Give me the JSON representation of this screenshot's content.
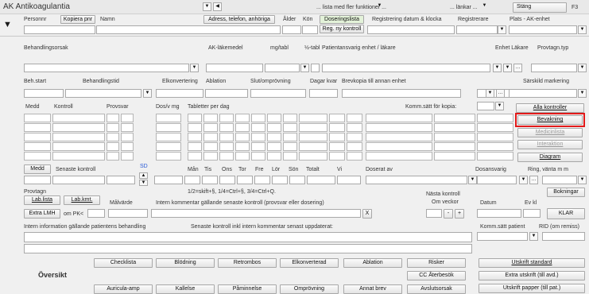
{
  "app_title": "AK Antikoagulantia",
  "top": {
    "lista_dropdown": "... lista med fler funktioner ...",
    "lankar_dropdown": "... länkar ...",
    "stang": "Stäng",
    "f3": "F3"
  },
  "row1": {
    "personnr": "Personnr",
    "kopiera_pnr": "Kopiera pnr",
    "namn": "Namn",
    "adress_btn": "Adress, telefon, anhöriga",
    "alder": "Ålder",
    "kon": "Kön",
    "doseringslista": "Doseringslista",
    "reg_ny_kontroll": "Reg. ny kontroll",
    "registrering": "Registrering datum & klocka",
    "registrerare": "Registrerare",
    "plats": "Plats - AK-enhet"
  },
  "row2": {
    "behandlingsorsak": "Behandlingsorsak",
    "ak_lakemedel": "AK-läkemedel",
    "mg_tabl": "mg/tabl",
    "half_tabl": "½-tabl",
    "patientansvarig": "Patientansvarig enhet / läkare",
    "enhet_lakare": "Enhet Läkare",
    "provtagn_typ": "Provtagn.typ"
  },
  "row3": {
    "beh_start": "Beh.start",
    "behandlingstid": "Behandlingstid",
    "elkonvertering": "Elkonvertering",
    "ablation": "Ablation",
    "slut": "Slut/omprövning",
    "dagar_kvar": "Dagar kvar",
    "brevkopia": "Brevkopia till annan enhet",
    "sarskild": "Särskild markering"
  },
  "grid": {
    "medd": "Medd",
    "kontroll": "Kontroll",
    "provsvar": "Provsvar",
    "dos": "Dos/v mg",
    "tabletter": "Tabletter per dag",
    "komm_satt": "Komm.sätt för kopia:"
  },
  "side_buttons": {
    "alla_kontroller": "Alla kontroller",
    "bevakning": "Bevakning",
    "medicinlista": "Medicinlista",
    "interaktion": "Interaktion",
    "diagram": "Diagram",
    "bokningar": "Bokningar",
    "klar": "KLAR"
  },
  "entry": {
    "medd": "Medd",
    "senaste_kontroll": "Senaste kontroll",
    "sd": "SD",
    "man": "Mån",
    "tis": "Tis",
    "ons": "Ons",
    "tor": "Tor",
    "fre": "Fre",
    "lor": "Lör",
    "son": "Sön",
    "totalt": "Totalt",
    "vi": "Vi",
    "doserat_av": "Doserat av",
    "dosansvarig": "Dosansvarig",
    "ring": "Ring, vänta m m"
  },
  "lower": {
    "provtagn": "Provtagn",
    "lab_lista": "Lab.lista",
    "lab_kmt": "Lab.kmt.",
    "extra_lmh": "Extra LMH",
    "om_pk": "om PK<",
    "malvarde": "Målvärde",
    "hint": "1/2=skift+§, 1/4=Ctrl+§, 3/4=Ctrl+Q.",
    "intern_kommentar": "Intern kommentar gällande senaste kontroll (provsvar eller dosering)",
    "x": "X",
    "nasta_kontroll": "Nästa kontroll",
    "om_veckor": "Om veckor",
    "minus": "-",
    "plus": "+",
    "datum": "Datum",
    "ev_kl": "Ev kl",
    "intern_info": "Intern information gällande patientens behandling",
    "senaste_info": "Senaste kontroll inkl intern kommentar senast uppdaterat:",
    "komm_satt_patient": "Komm.sätt patient",
    "rid": "RID (om remiss)"
  },
  "bottom": {
    "oversikt": "Översikt",
    "row1": [
      "Checklista",
      "Blödning",
      "Retrombos",
      "Elkonverterad",
      "Ablation",
      "Risker"
    ],
    "cc_aterbesok": "CC Återbesök",
    "row3": [
      "Auricula-amp",
      "Kallelse",
      "Påminnelse",
      "Omprövning",
      "Annat brev",
      "Avslutsorsak"
    ],
    "utskrift_standard": "Utskrift standard",
    "extra_utskrift": "Extra utskrift (till avd.)",
    "utskrift_papper": "Utskrift papper (till pat.)"
  },
  "colors": {
    "highlight": "#e21a1a",
    "green_button": "#e3f2d9"
  }
}
